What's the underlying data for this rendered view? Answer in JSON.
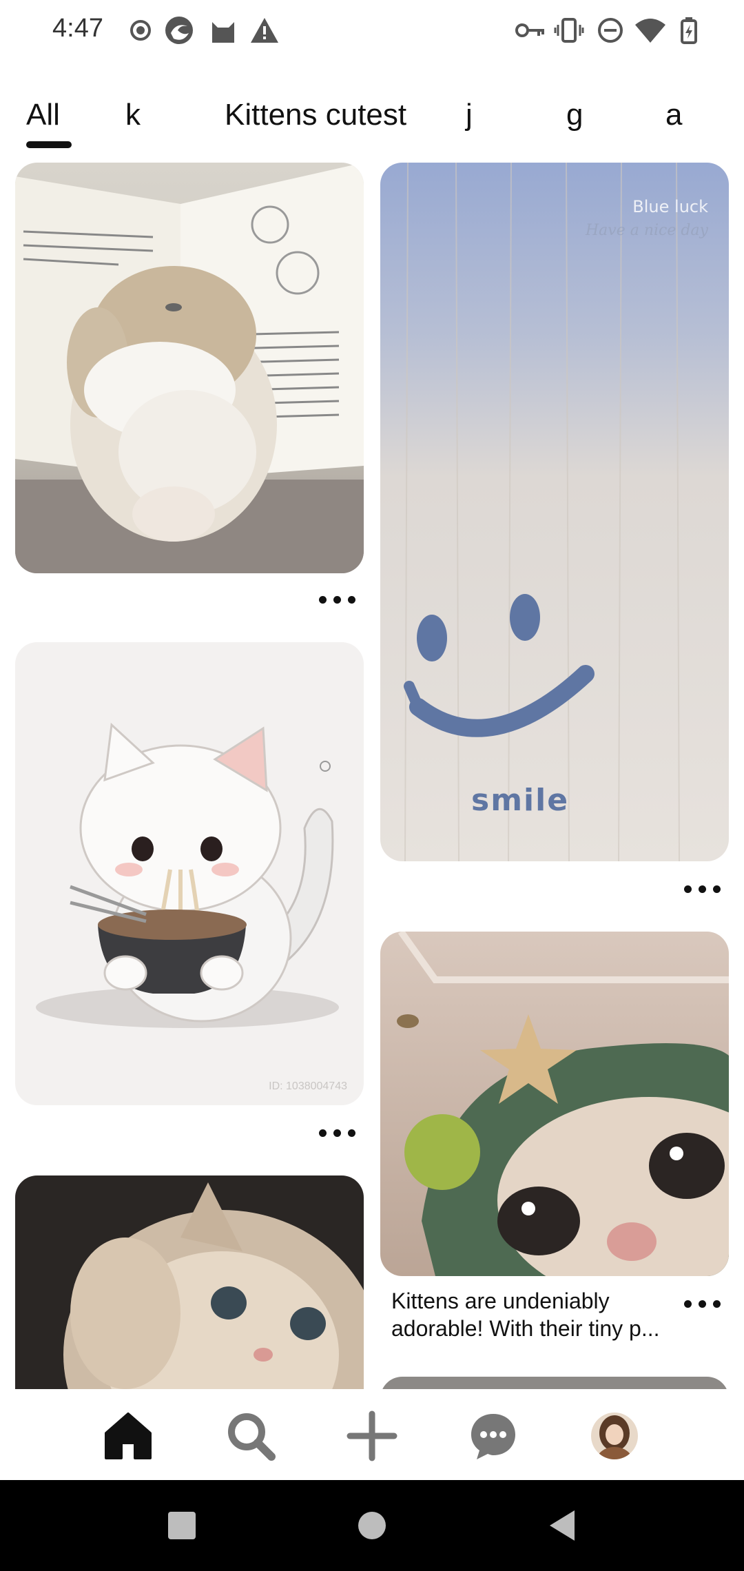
{
  "status_bar": {
    "time": "4:47",
    "left_icons": [
      "record-icon",
      "browser-icon",
      "cat-app-icon",
      "warning-icon"
    ],
    "right_icons": [
      "key-icon",
      "vibrate-icon",
      "dnd-icon",
      "wifi-icon",
      "battery-charging-icon"
    ]
  },
  "tabs": [
    {
      "label": "All",
      "active": true
    },
    {
      "label": "k",
      "active": false
    },
    {
      "label": "Kittens cutest",
      "active": false
    },
    {
      "label": "j",
      "active": false
    },
    {
      "label": "g",
      "active": false
    },
    {
      "label": "a",
      "active": false
    }
  ],
  "pins": {
    "bunny": {
      "subject": "bunny-with-book"
    },
    "smile": {
      "overlay_title": "Blue luck",
      "overlay_sub": "Have a nice day",
      "caption": "smile"
    },
    "noodle_cat": {
      "watermark": "ID: 1038004743"
    },
    "hoodie_kitten": {
      "description": "Kittens are undeniably adorable! With their tiny p..."
    },
    "paw_kitten": {
      "subject": "kitten-raising-paw"
    }
  },
  "bottom_nav": [
    "home-icon",
    "search-icon",
    "create-plus-icon",
    "messages-icon",
    "profile-avatar"
  ],
  "system_nav": [
    "recents-icon",
    "home-circle-icon",
    "back-icon"
  ]
}
